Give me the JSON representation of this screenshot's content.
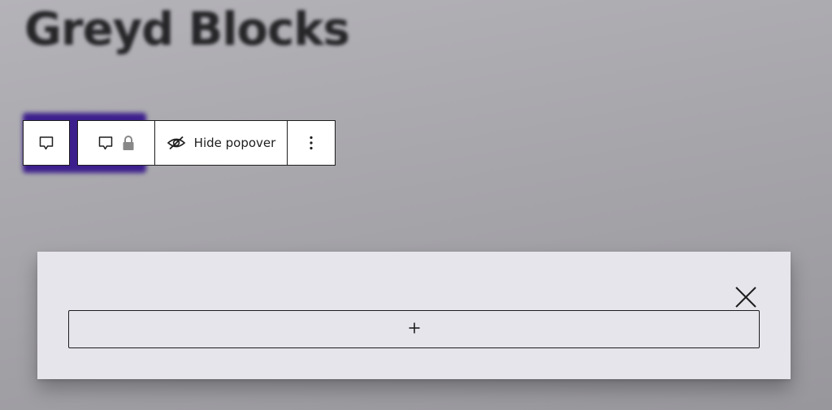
{
  "site": {
    "title": "Greyd Blocks"
  },
  "toolbar": {
    "parent_icon": "speech-bubble-icon",
    "block_icon": "speech-bubble-icon",
    "lock_icon": "lock-icon",
    "hide_popover_label": "Hide popover",
    "hide_popover_icon": "eye-slash-icon",
    "options_icon": "vertical-ellipsis-icon"
  },
  "popover": {
    "close_icon": "close-icon",
    "add_block_icon": "plus-icon"
  },
  "colors": {
    "background": "#a7a6ab",
    "popover_background": "#e7e5ec",
    "selected_block": "#3c1f8c",
    "ink": "#1e1e1e"
  }
}
